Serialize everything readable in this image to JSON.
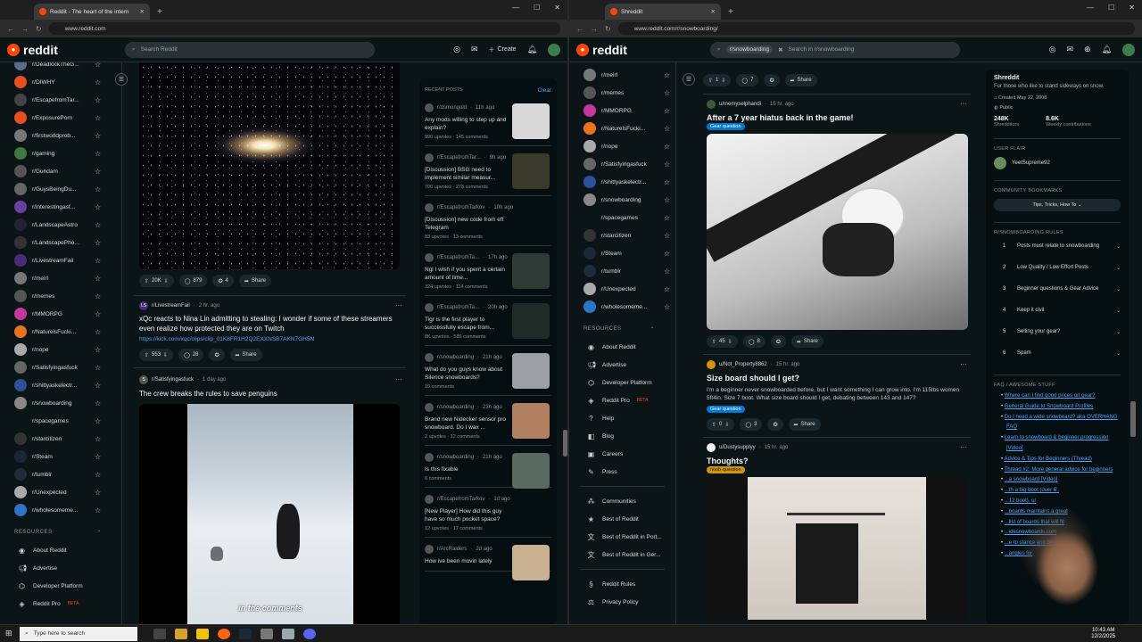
{
  "left_window": {
    "tab_title": "Reddit - The heart of the intern",
    "url": "www.reddit.com",
    "search_placeholder": "Search Reddit",
    "create_label": "Create",
    "sidebar": [
      {
        "name": "r/DeadlockTheG...",
        "color": "#5b6b8c"
      },
      {
        "name": "r/DIWHY",
        "color": "#e94e1b"
      },
      {
        "name": "r/EscapefromTar...",
        "color": "#444"
      },
      {
        "name": "r/ExposurePorn",
        "color": "#e94e1b"
      },
      {
        "name": "r/firstworldprob...",
        "color": "#777"
      },
      {
        "name": "r/gaming",
        "color": "#3d7a3d"
      },
      {
        "name": "r/Gundam",
        "color": "#555"
      },
      {
        "name": "r/GuysBeingDu...",
        "color": "#666"
      },
      {
        "name": "r/interestingasf...",
        "color": "#6b3fa0"
      },
      {
        "name": "r/LandscapeAstro",
        "color": "#223"
      },
      {
        "name": "r/LandscapePho...",
        "color": "#333"
      },
      {
        "name": "r/LivestreamFail",
        "color": "#4a2a7a"
      },
      {
        "name": "r/meirl",
        "color": "#777"
      },
      {
        "name": "r/memes",
        "color": "#555"
      },
      {
        "name": "r/MMORPG",
        "color": "#c4379c"
      },
      {
        "name": "r/NaturelsFucki...",
        "color": "#e9731b"
      },
      {
        "name": "r/nope",
        "color": "#aaa"
      },
      {
        "name": "r/Satisfyingasfuck",
        "color": "#666"
      },
      {
        "name": "r/shittyaskelectr...",
        "color": "#2c4f9e"
      },
      {
        "name": "r/snowboarding",
        "color": "#888"
      },
      {
        "name": "r/spacegames",
        "color": "#0b1416"
      },
      {
        "name": "r/starcitizen",
        "color": "#333"
      },
      {
        "name": "r/Steam",
        "color": "#1b2838"
      },
      {
        "name": "r/tumblr",
        "color": "#1f2c3c"
      },
      {
        "name": "r/Unexpected",
        "color": "#aaa"
      },
      {
        "name": "r/wholesomeme...",
        "color": "#2a76c6"
      }
    ],
    "resources_label": "RESOURCES",
    "resources": [
      {
        "label": "About Reddit",
        "icon": "reddit-icon"
      },
      {
        "label": "Advertise",
        "icon": "megaphone-icon"
      },
      {
        "label": "Developer Platform",
        "icon": "code-icon"
      },
      {
        "label": "Reddit Pro",
        "icon": "pro-icon",
        "badge": "BETA"
      }
    ],
    "post1": {
      "votes": "20K",
      "comments": "879",
      "awards": "4",
      "share": "Share"
    },
    "post2": {
      "subreddit": "r/LivestreamFail",
      "time": "2 hr. ago",
      "title": "xQc reacts to Nina Lin admitting to stealing: I wonder if some of these streamers even realize how protected they are on Twitch",
      "link": "https://kick.com/xqc/clips/clip_01K8FR1H2Q2EXXNSB7AKN7GH5N",
      "votes": "553",
      "comments": "28",
      "share": "Share"
    },
    "post3": {
      "subreddit": "r/Satisfyingasfuck",
      "time": "1 day ago",
      "title": "The crew breaks the rules to save penguins",
      "caption": "in the comments"
    },
    "recent": {
      "heading": "RECENT POSTS",
      "clear": "Clear",
      "items": [
        {
          "sub": "r/dsmongold",
          "time": "11h ago",
          "title": "Any mods willing to step up and explain?",
          "stats": "990 upvotes · 145 comments",
          "thumb": "#d9d9d9"
        },
        {
          "sub": "r/EscapefromTar...",
          "time": "9h ago",
          "title": "[Discussion] BSG need to implement similar measur...",
          "stats": "700 upvotes · 278 comments",
          "thumb": "#3a3a2a"
        },
        {
          "sub": "r/EscapefromTarkov",
          "time": "10h ago",
          "title": "[Discussion] new code from eft Telegram",
          "stats": "83 upvotes · 13 comments",
          "thumb": ""
        },
        {
          "sub": "r/EscapefromTa...",
          "time": "17h ago",
          "title": "Ngl I wish if you spent a certain amount of time...",
          "stats": "324 upvotes · 114 comments",
          "thumb": "#2f3a36"
        },
        {
          "sub": "r/EscapefromTa...",
          "time": "20h ago",
          "title": "Tigr is the first player to successfully escape from...",
          "stats": "8K upvotes · 586 comments",
          "thumb": "#1f2b26"
        },
        {
          "sub": "r/snowboarding",
          "time": "21h ago",
          "title": "What do you guys know about Silence snowboards?",
          "stats": "10 comments",
          "thumb": "#9aa0a3"
        },
        {
          "sub": "r/snowboarding",
          "time": "23h ago",
          "title": "Brand new Nidecker sensor pro snowboard. Do I wax ...",
          "stats": "2 upvotes · 12 comments",
          "thumb": "#b08060"
        },
        {
          "sub": "r/snowboarding",
          "time": "21h ago",
          "title": "Is this fixable",
          "stats": "6 comments",
          "thumb": "#5a6a60"
        },
        {
          "sub": "r/EscapefromTarkov",
          "time": "1d ago",
          "title": "[New Player] How did this guy have so much pocket space?",
          "stats": "12 upvotes · 17 comments",
          "thumb": ""
        },
        {
          "sub": "r/ArcRaiders",
          "time": "2d ago",
          "title": "How ive been movin lately",
          "stats": "",
          "thumb": "#c8b090"
        }
      ]
    }
  },
  "right_window": {
    "tab_title": "Shreddit",
    "url": "www.reddit.com/r/snowboarding/",
    "search_chip": "r/snowboarding",
    "search_placeholder": "Search in r/snowboarding",
    "sidebar": [
      {
        "name": "r/meirl",
        "color": "#777"
      },
      {
        "name": "r/memes",
        "color": "#555"
      },
      {
        "name": "r/MMORPG",
        "color": "#c4379c"
      },
      {
        "name": "r/NaturelsFucki...",
        "color": "#e9731b"
      },
      {
        "name": "r/nope",
        "color": "#aaa"
      },
      {
        "name": "r/Satisfyingasfuck",
        "color": "#666"
      },
      {
        "name": "r/shittyaskelectr...",
        "color": "#2c4f9e"
      },
      {
        "name": "r/snowboarding",
        "color": "#888"
      },
      {
        "name": "r/spacegames",
        "color": "#0b1416"
      },
      {
        "name": "r/starcitizen",
        "color": "#333"
      },
      {
        "name": "r/Steam",
        "color": "#1b2838"
      },
      {
        "name": "r/tumblr",
        "color": "#1f2c3c"
      },
      {
        "name": "r/Unexpected",
        "color": "#aaa"
      },
      {
        "name": "r/wholesomeme...",
        "color": "#2a76c6"
      }
    ],
    "resources_label": "RESOURCES",
    "resources": [
      {
        "label": "About Reddit",
        "icon": "reddit-icon"
      },
      {
        "label": "Advertise",
        "icon": "megaphone-icon"
      },
      {
        "label": "Developer Platform",
        "icon": "code-icon"
      },
      {
        "label": "Reddit Pro",
        "icon": "pro-icon",
        "badge": "BETA"
      },
      {
        "label": "Help",
        "icon": "help-icon"
      },
      {
        "label": "Blog",
        "icon": "blog-icon"
      },
      {
        "label": "Careers",
        "icon": "careers-icon"
      },
      {
        "label": "Press",
        "icon": "press-icon"
      },
      {
        "label": "Communities",
        "icon": "communities-icon"
      },
      {
        "label": "Best of Reddit",
        "icon": "best-icon"
      },
      {
        "label": "Best of Reddit in Port...",
        "icon": "translate-icon"
      },
      {
        "label": "Best of Reddit in Ger...",
        "icon": "translate-icon"
      },
      {
        "label": "Reddit Rules",
        "icon": "rules-icon"
      },
      {
        "label": "Privacy Policy",
        "icon": "privacy-icon"
      }
    ],
    "top_actions": {
      "votes": "1",
      "comments": "7",
      "share": "Share"
    },
    "postA": {
      "user": "u/memyselphandi",
      "time": "15 hr. ago",
      "title": "After a 7 year hiatus back in the game!",
      "flair": "Gear question",
      "votes": "45",
      "comments": "8",
      "share": "Share"
    },
    "postB": {
      "user": "u/Not_Property8862",
      "time": "15 hr. ago",
      "title": "Size board should I get?",
      "body": "I'm a beginner never snowboarded before, but I want something I can grow into. I'm 115lbs women 5ft4in. Size 7 boot. What size board should I get, debating between 143 and 147?",
      "flair": "Gear question",
      "votes": "0",
      "comments": "3",
      "share": "Share"
    },
    "postC": {
      "user": "u/Dustysupplyy",
      "time": "15 hr. ago",
      "title": "Thoughts?",
      "flair": "noob question"
    },
    "community": {
      "name": "Shreddit",
      "description": "For those who like to stand sideways on snow.",
      "created": "Created May 22, 2008",
      "visibility": "Public",
      "members": "248K",
      "members_label": "Shredditors",
      "contrib": "8.6K",
      "contrib_label": "Weekly contributions",
      "user_flair_heading": "USER FLAIR",
      "user_flair": "YeetSupreme92",
      "bookmarks_heading": "COMMUNITY BOOKMARKS",
      "bookmark": "Tips, Tricks, How To",
      "rules_heading": "R/SNOWBOARDING RULES",
      "rules": [
        "Posts must relate to snowboarding",
        "Low Quality / Low Effort Posts",
        "Beginner questions & Gear Advice",
        "Keep it civil",
        "Selling your gear?",
        "Spam"
      ],
      "faq_heading": "FAQ / AWESOME STUFF",
      "faq": [
        "Where can I find good prices on gear?",
        "General Guide to Snowboard Profiles",
        "Do I need a wide snowboard? aka OVERHANG FAQ",
        "Learn to snowboard & beginner progression [Video]",
        "Advice & Tips for Beginners (Thread)",
        "Thread #2: More general advice for beginners",
        "...a snowboard [Video]",
        "...th a big boot (over 6',",
        "...12 boot). u/",
        "...boards maintains a great",
        "...list of boards that will fit",
        "...idesnowboards.com",
        "...e to stance and binding",
        "...angles for"
      ]
    }
  },
  "taskbar": {
    "search_placeholder": "Type here to search",
    "time": "10:43 AM",
    "date": "12/2/2025"
  }
}
